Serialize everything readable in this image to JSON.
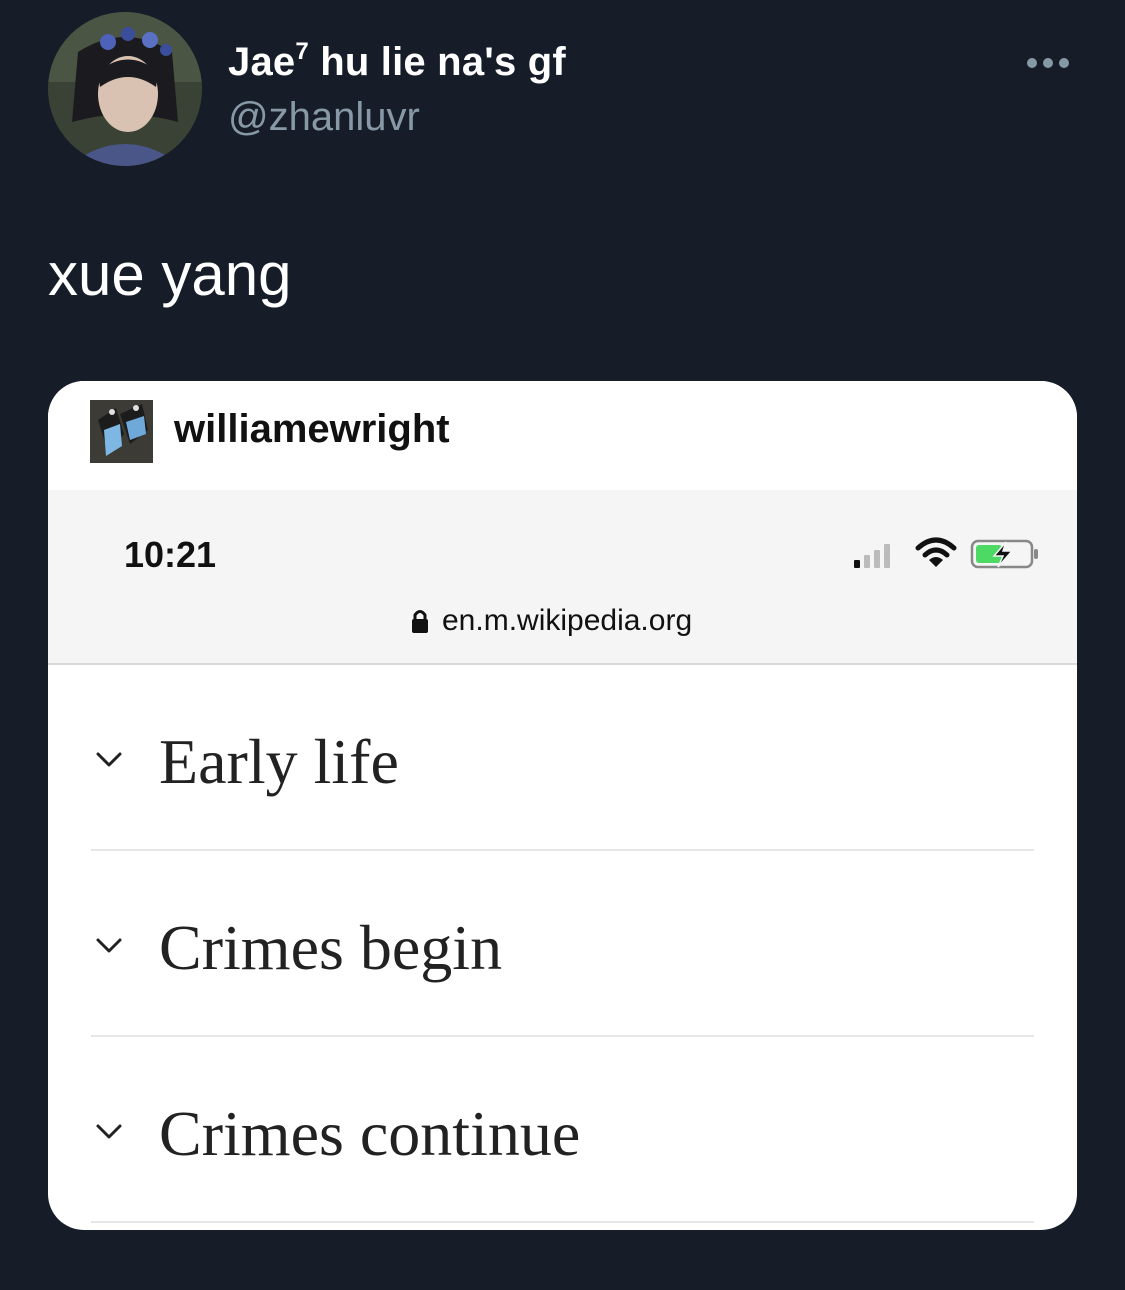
{
  "tweet": {
    "display_name": "Jae",
    "display_name_superscript": "7",
    "display_name_rest": " hu lie na's gf",
    "handle": "@zhanluvr",
    "text": "xue yang"
  },
  "icons": {
    "more": "more-horizontal-icon",
    "chevron": "chevron-down-icon",
    "lock": "lock-icon",
    "signal": "cellular-signal-icon",
    "wifi": "wifi-icon",
    "battery": "battery-charging-icon"
  },
  "card": {
    "poster_name": "williamewright",
    "status_bar": {
      "time": "10:21",
      "url": "en.m.wikipedia.org"
    },
    "sections": [
      {
        "title": "Early life"
      },
      {
        "title": "Crimes begin"
      },
      {
        "title": "Crimes continue"
      }
    ]
  },
  "colors": {
    "background": "#161d29",
    "secondary_text": "#8899a6",
    "battery_green": "#4cd964"
  }
}
